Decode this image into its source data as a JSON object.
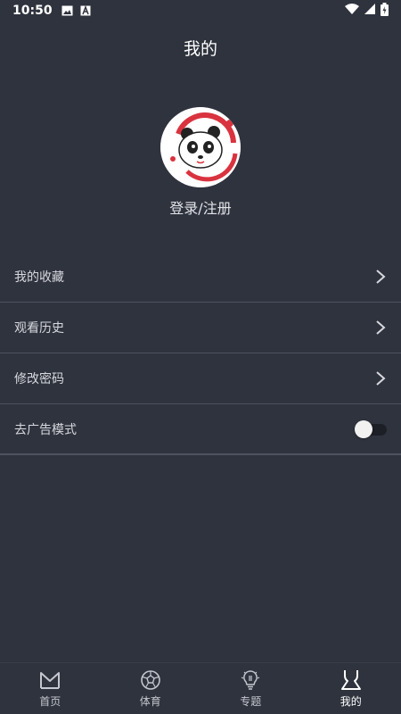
{
  "status_bar": {
    "time": "10:50",
    "icons": [
      "image-icon",
      "text-a-icon",
      "wifi-icon",
      "signal-icon",
      "battery-icon"
    ]
  },
  "header": {
    "title": "我的"
  },
  "profile": {
    "login_label": "登录/注册",
    "avatar_icon": "panda-avatar-icon"
  },
  "menu": {
    "items": [
      {
        "label": "我的收藏",
        "control": "chevron"
      },
      {
        "label": "观看历史",
        "control": "chevron"
      },
      {
        "label": "修改密码",
        "control": "chevron"
      },
      {
        "label": "去广告模式",
        "control": "toggle",
        "toggle_on": false
      }
    ]
  },
  "tabs": [
    {
      "label": "首页",
      "icon": "m-logo-icon",
      "active": false
    },
    {
      "label": "体育",
      "icon": "soccer-ball-icon",
      "active": false
    },
    {
      "label": "专题",
      "icon": "lightbulb-icon",
      "active": false
    },
    {
      "label": "我的",
      "icon": "person-outline-icon",
      "active": true
    }
  ],
  "colors": {
    "background": "#2f333e",
    "divider": "#4d5260",
    "text_primary": "#ffffff",
    "text_secondary": "#d6d8dd",
    "accent_red": "#d9333f"
  }
}
